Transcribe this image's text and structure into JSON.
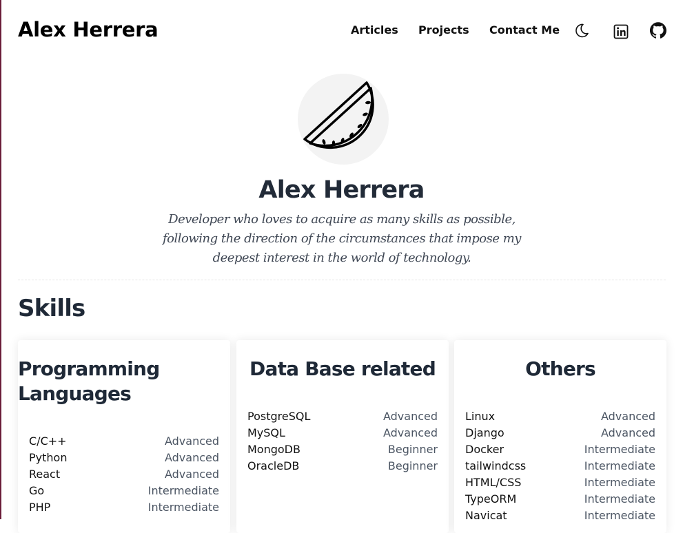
{
  "header": {
    "brand": "Alex Herrera",
    "nav": [
      "Articles",
      "Projects",
      "Contact Me"
    ]
  },
  "icons": {
    "theme": "moon-icon",
    "linkedin": "linkedin-icon",
    "github": "github-icon",
    "avatar": "watermelon-icon"
  },
  "hero": {
    "name": "Alex Herrera",
    "tagline": "Developer who loves to acquire as many skills as possible, following the direction of the circumstances that impose my deepest interest in the world of technology."
  },
  "skills": {
    "title": "Skills",
    "cards": [
      {
        "title": "Programming Languages",
        "items": [
          {
            "name": "C/C++",
            "level": "Advanced"
          },
          {
            "name": "Python",
            "level": "Advanced"
          },
          {
            "name": "React",
            "level": "Advanced"
          },
          {
            "name": "Go",
            "level": "Intermediate"
          },
          {
            "name": "PHP",
            "level": "Intermediate"
          }
        ]
      },
      {
        "title": "Data Base related",
        "items": [
          {
            "name": "PostgreSQL",
            "level": "Advanced"
          },
          {
            "name": "MySQL",
            "level": "Advanced"
          },
          {
            "name": "MongoDB",
            "level": "Beginner"
          },
          {
            "name": "OracleDB",
            "level": "Beginner"
          }
        ]
      },
      {
        "title": "Others",
        "items": [
          {
            "name": "Linux",
            "level": "Advanced"
          },
          {
            "name": "Django",
            "level": "Advanced"
          },
          {
            "name": "Docker",
            "level": "Intermediate"
          },
          {
            "name": "tailwindcss",
            "level": "Intermediate"
          },
          {
            "name": "HTML/CSS",
            "level": "Intermediate"
          },
          {
            "name": "TypeORM",
            "level": "Intermediate"
          },
          {
            "name": "Navicat",
            "level": "Intermediate"
          }
        ]
      }
    ]
  }
}
